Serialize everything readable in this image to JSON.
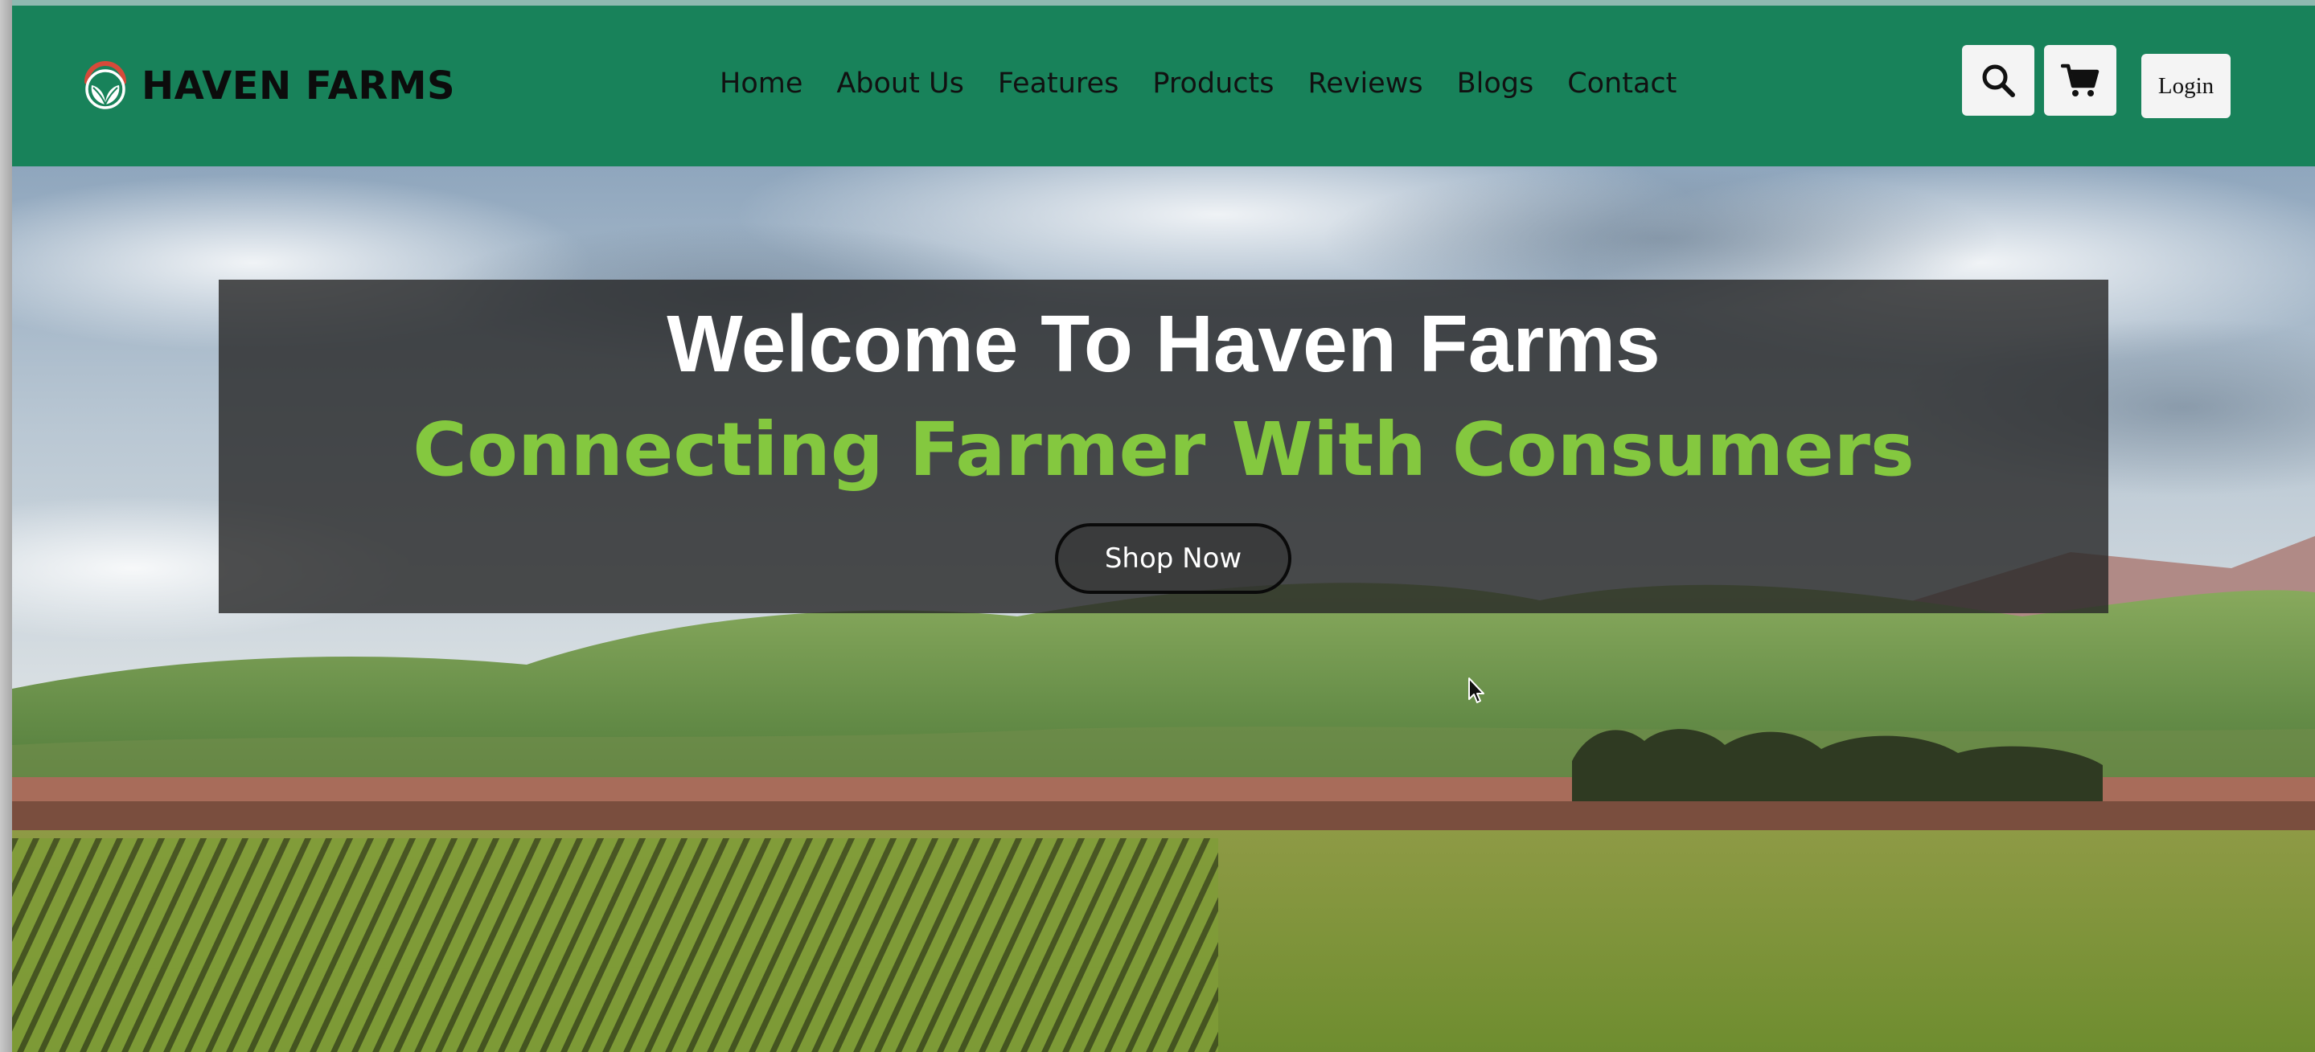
{
  "colors": {
    "header_bg": "#18825a",
    "accent_green": "#84c83f",
    "overlay": "rgba(38,38,38,0.80)"
  },
  "brand": {
    "name": "HAVEN FARMS",
    "logo_icon": "leaf-logo-icon"
  },
  "nav": {
    "items": [
      {
        "label": "Home"
      },
      {
        "label": "About Us"
      },
      {
        "label": "Features"
      },
      {
        "label": "Products"
      },
      {
        "label": "Reviews"
      },
      {
        "label": "Blogs"
      },
      {
        "label": "Contact"
      }
    ]
  },
  "header_actions": {
    "search_icon": "search-icon",
    "cart_icon": "cart-icon",
    "login_label": "Login"
  },
  "hero": {
    "title": "Welcome To Haven Farms",
    "tagline": "Connecting Farmer With Consumers",
    "cta_label": "Shop Now",
    "background": "farm-field-landscape"
  }
}
